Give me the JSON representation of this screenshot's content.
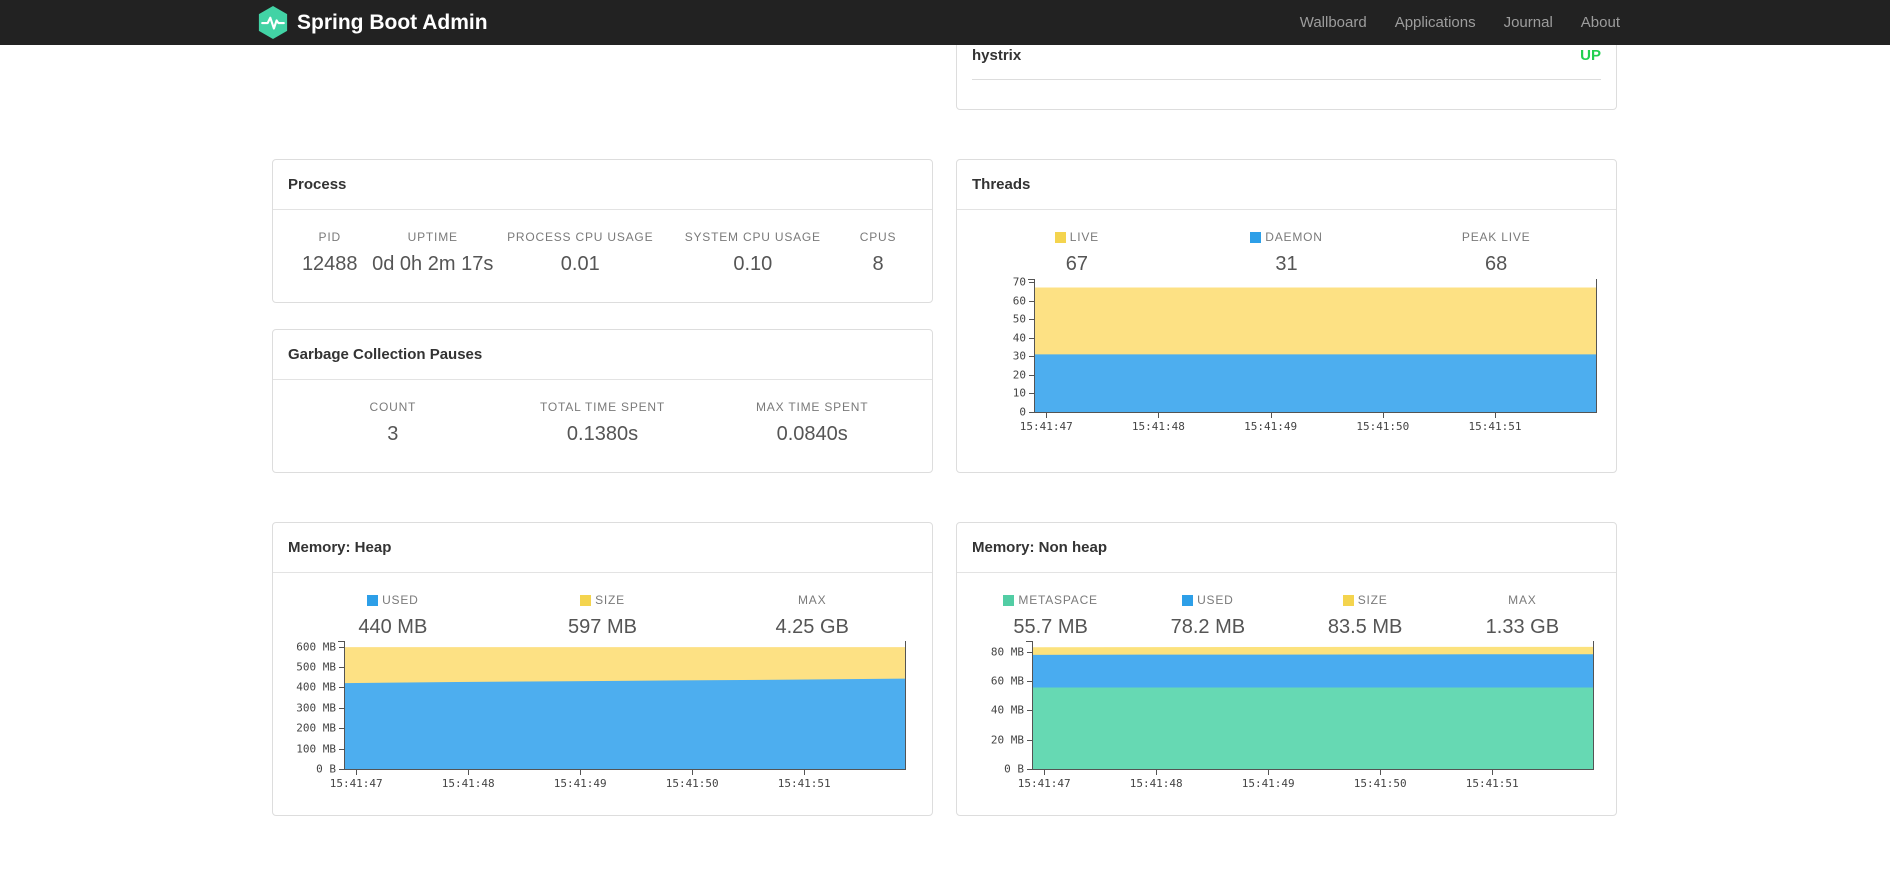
{
  "navbar": {
    "brand": "Spring Boot Admin",
    "brand_color": "#42d3a5",
    "items": [
      {
        "label": "Wallboard"
      },
      {
        "label": "Applications"
      },
      {
        "label": "Journal"
      },
      {
        "label": "About"
      }
    ]
  },
  "status_panel": {
    "application": "hystrix",
    "status": "UP",
    "status_color": "#21cf4f"
  },
  "panels": {
    "process": {
      "title": "Process",
      "metrics": [
        {
          "label": "PID",
          "value": "12488"
        },
        {
          "label": "UPTIME",
          "value": "0d 0h 2m 17s"
        },
        {
          "label": "PROCESS CPU USAGE",
          "value": "0.01"
        },
        {
          "label": "SYSTEM CPU USAGE",
          "value": "0.10"
        },
        {
          "label": "CPUS",
          "value": "8"
        }
      ]
    },
    "gc": {
      "title": "Garbage Collection Pauses",
      "metrics": [
        {
          "label": "COUNT",
          "value": "3"
        },
        {
          "label": "TOTAL TIME SPENT",
          "value": "0.1380s"
        },
        {
          "label": "MAX TIME SPENT",
          "value": "0.0840s"
        }
      ]
    },
    "threads": {
      "title": "Threads",
      "metrics": [
        {
          "label": "LIVE",
          "value": "67",
          "color": "#f4d44e"
        },
        {
          "label": "DAEMON",
          "value": "31",
          "color": "#2d9fe8"
        },
        {
          "label": "PEAK LIVE",
          "value": "68"
        }
      ]
    },
    "heap": {
      "title": "Memory: Heap",
      "metrics": [
        {
          "label": "USED",
          "value": "440 MB",
          "color": "#2d9fe8"
        },
        {
          "label": "SIZE",
          "value": "597 MB",
          "color": "#f4d44e"
        },
        {
          "label": "MAX",
          "value": "4.25 GB"
        }
      ]
    },
    "nonheap": {
      "title": "Memory: Non heap",
      "metrics": [
        {
          "label": "METASPACE",
          "value": "55.7 MB",
          "color": "#52cda4"
        },
        {
          "label": "USED",
          "value": "78.2 MB",
          "color": "#2d9fe8"
        },
        {
          "label": "SIZE",
          "value": "83.5 MB",
          "color": "#f4d44e"
        },
        {
          "label": "MAX",
          "value": "1.33 GB"
        }
      ]
    }
  },
  "chart_data": [
    {
      "type": "area",
      "title": "Threads",
      "legend_position": "above",
      "grid": false,
      "x": [
        "15:41:47",
        "15:41:48",
        "15:41:49",
        "15:41:50",
        "15:41:51"
      ],
      "x_positions": [
        0.02,
        0.22,
        0.42,
        0.62,
        0.82
      ],
      "ylim": [
        0,
        71.6
      ],
      "yticks": [
        {
          "v": 0,
          "label": "0"
        },
        {
          "v": 10,
          "label": "10"
        },
        {
          "v": 20,
          "label": "20"
        },
        {
          "v": 30,
          "label": "30"
        },
        {
          "v": 40,
          "label": "40"
        },
        {
          "v": 50,
          "label": "50"
        },
        {
          "v": 60,
          "label": "60"
        },
        {
          "v": 70,
          "label": "70"
        }
      ],
      "series": [
        {
          "name": "LIVE",
          "color": "#fde184",
          "values": [
            67,
            67,
            67,
            67,
            67,
            67
          ]
        },
        {
          "name": "DAEMON",
          "color": "#4daeef",
          "values": [
            31,
            31,
            31,
            31,
            31,
            31
          ]
        }
      ]
    },
    {
      "type": "area",
      "title": "Memory: Heap (MB)",
      "legend_position": "above",
      "grid": false,
      "x": [
        "15:41:47",
        "15:41:48",
        "15:41:49",
        "15:41:50",
        "15:41:51"
      ],
      "x_positions": [
        0.02,
        0.22,
        0.42,
        0.62,
        0.82
      ],
      "ylim": [
        0,
        627
      ],
      "yticks": [
        {
          "v": 0,
          "label": "0 B"
        },
        {
          "v": 100,
          "label": "100 MB"
        },
        {
          "v": 200,
          "label": "200 MB"
        },
        {
          "v": 300,
          "label": "300 MB"
        },
        {
          "v": 400,
          "label": "400 MB"
        },
        {
          "v": 500,
          "label": "500 MB"
        },
        {
          "v": 600,
          "label": "600 MB"
        }
      ],
      "series": [
        {
          "name": "SIZE",
          "color": "#fde184",
          "values": [
            597,
            597,
            597,
            597,
            597,
            597
          ]
        },
        {
          "name": "USED",
          "color": "#4daeef",
          "values": [
            421,
            426,
            430,
            434,
            438,
            443
          ]
        }
      ]
    },
    {
      "type": "area",
      "title": "Memory: Non heap (MB)",
      "legend_position": "above",
      "grid": false,
      "x": [
        "15:41:47",
        "15:41:48",
        "15:41:49",
        "15:41:50",
        "15:41:51"
      ],
      "x_positions": [
        0.02,
        0.22,
        0.42,
        0.62,
        0.82
      ],
      "ylim": [
        0,
        87.5
      ],
      "yticks": [
        {
          "v": 0,
          "label": "0 B"
        },
        {
          "v": 20,
          "label": "20 MB"
        },
        {
          "v": 40,
          "label": "40 MB"
        },
        {
          "v": 60,
          "label": "60 MB"
        },
        {
          "v": 80,
          "label": "80 MB"
        }
      ],
      "series": [
        {
          "name": "SIZE",
          "color": "#fce27d",
          "values": [
            83.2,
            83.3,
            83.4,
            83.5,
            83.5,
            83.5
          ]
        },
        {
          "name": "USED",
          "color": "#49acf0",
          "values": [
            78.0,
            78.2,
            78.2,
            78.3,
            78.4,
            78.4
          ]
        },
        {
          "name": "METASPACE",
          "color": "#66d9b3",
          "values": [
            55.7,
            55.7,
            55.7,
            55.7,
            55.7,
            55.7
          ]
        }
      ]
    }
  ]
}
